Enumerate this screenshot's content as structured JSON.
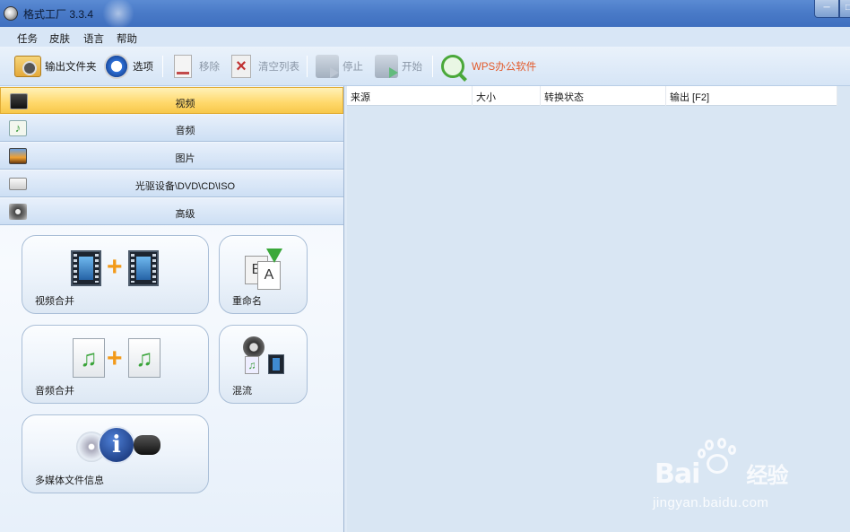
{
  "window": {
    "title": "格式工厂 3.3.4",
    "minimize_glyph": "─",
    "maximize_glyph": "□"
  },
  "menu": {
    "items": [
      "任务",
      "皮肤",
      "语言",
      "帮助"
    ]
  },
  "toolbar": {
    "output_folder": "输出文件夹",
    "options": "选项",
    "remove": "移除",
    "clear_list": "清空列表",
    "stop": "停止",
    "start": "开始",
    "wps": "WPS办公软件",
    "wps_color": "#e2592a"
  },
  "categories": [
    {
      "label": "视频",
      "icon": "video-icon",
      "active": true
    },
    {
      "label": "音频",
      "icon": "audio-icon",
      "active": false
    },
    {
      "label": "图片",
      "icon": "image-icon",
      "active": false
    },
    {
      "label": "光驱设备\\DVD\\CD\\ISO",
      "icon": "optical-drive-icon",
      "active": false
    },
    {
      "label": "高级",
      "icon": "advanced-icon",
      "active": false
    }
  ],
  "tools": {
    "video_merge": "视频合并",
    "rename": "重命名",
    "audio_merge": "音频合并",
    "mux": "混流",
    "media_info": "多媒体文件信息",
    "plus_sign": "+",
    "note_glyph": "♫",
    "rename_letters": [
      "B",
      "A"
    ]
  },
  "file_list": {
    "columns": [
      "来源",
      "大小",
      "转换状态",
      "输出 [F2]"
    ],
    "rows": []
  },
  "colors": {
    "active_category": "#ffd86a",
    "title_bar": "#4a7bc8"
  },
  "watermark": {
    "logo_left": "Bai",
    "logo_right": "经验",
    "url": "jingyan.baidu.com"
  }
}
